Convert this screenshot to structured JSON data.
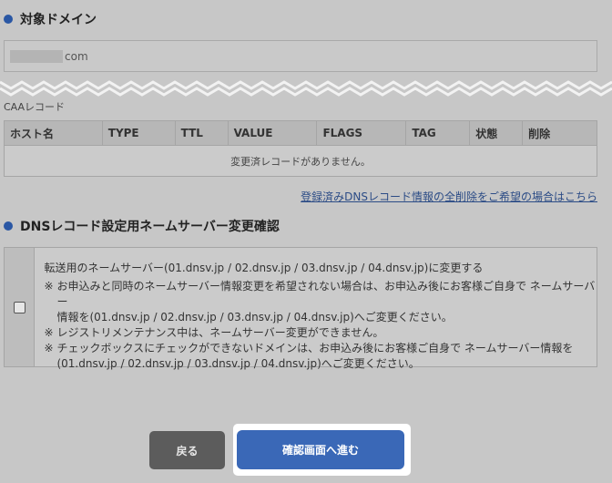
{
  "section1": {
    "title": "対象ドメイン",
    "bullet_color": "#2a57a4"
  },
  "domain": {
    "suffix": "com"
  },
  "caa": {
    "label": "CAAレコード",
    "columns": [
      "ホスト名",
      "TYPE",
      "TTL",
      "VALUE",
      "FLAGS",
      "TAG",
      "状態",
      "削除"
    ],
    "empty_message": "変更済レコードがありません。"
  },
  "delete_all_link": "登録済みDNSレコード情報の全削除をご希望の場合はこちら",
  "section2": {
    "title": "DNSレコード設定用ネームサーバー変更確認",
    "bullet_color": "#2a57a4"
  },
  "confirm": {
    "checked": false,
    "main_text": "転送用のネームサーバー(01.dnsv.jp / 02.dnsv.jp / 03.dnsv.jp / 04.dnsv.jp)に変更する",
    "note_mark": "※",
    "notes": [
      [
        "お申込みと同時のネームサーバー情報変更を希望されない場合は、お申込み後にお客様ご自身で ネームサーバー",
        "情報を(01.dnsv.jp / 02.dnsv.jp / 03.dnsv.jp / 04.dnsv.jp)へご変更ください。"
      ],
      [
        "レジストリメンテナンス中は、ネームサーバー変更ができません。"
      ],
      [
        "チェックボックスにチェックができないドメインは、お申込み後にお客様ご自身で ネームサーバー情報を",
        "(01.dnsv.jp / 02.dnsv.jp / 03.dnsv.jp / 04.dnsv.jp)へご変更ください。"
      ]
    ]
  },
  "buttons": {
    "back": "戻る",
    "next": "確認画面へ進む",
    "next_color": "#3a68b7"
  }
}
